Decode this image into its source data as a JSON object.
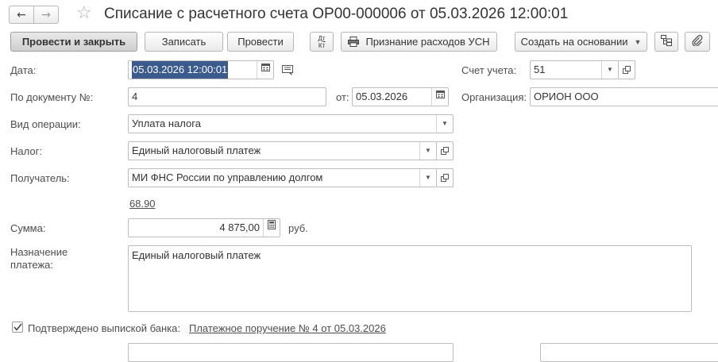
{
  "header": {
    "title": "Списание с расчетного счета ОР00-000006 от 05.03.2026 12:00:01"
  },
  "toolbar": {
    "post_and_close": "Провести и закрыть",
    "save": "Записать",
    "post": "Провести",
    "dt_kt_icon_top": "Дт",
    "dt_kt_icon_bottom": "Кт",
    "usn_expenses": "Признание расходов УСН",
    "create_based_on": "Создать на основании"
  },
  "form": {
    "date_label": "Дата:",
    "date_value": "05.03.2026 12:00:01",
    "doc_number_label": "По документу №:",
    "doc_number_value": "4",
    "from_label": "от:",
    "from_value": "05.03.2026",
    "account_label": "Счет учета:",
    "account_value": "51",
    "organization_label": "Организация:",
    "organization_value": "ОРИОН ООО",
    "operation_label": "Вид операции:",
    "operation_value": "Уплата налога",
    "tax_label": "Налог:",
    "tax_value": "Единый налоговый платеж",
    "recipient_label": "Получатель:",
    "recipient_value": "МИ ФНС России по управлению долгом",
    "recipient_account_link": "68.90",
    "amount_label": "Сумма:",
    "amount_value": "4 875,00",
    "currency": "руб.",
    "purpose_label_line1": "Назначение",
    "purpose_label_line2": "платежа:",
    "purpose_value": "Единый налоговый платеж",
    "confirmed_label": "Подтверждено выпиской банка:",
    "confirmed_checked": true,
    "payment_order_link": "Платежное поручение № 4 от 05.03.2026"
  },
  "icons": {
    "back": "arrow-left-icon",
    "forward": "arrow-right-icon",
    "favorite": "star-icon",
    "calendar": "calendar-icon",
    "calculator": "calculator-icon",
    "printer": "printer-icon",
    "open": "open-link-icon",
    "dropdown": "chevron-down-icon",
    "attach": "paperclip-icon",
    "structure": "structure-icon",
    "comment": "comment-icon"
  }
}
